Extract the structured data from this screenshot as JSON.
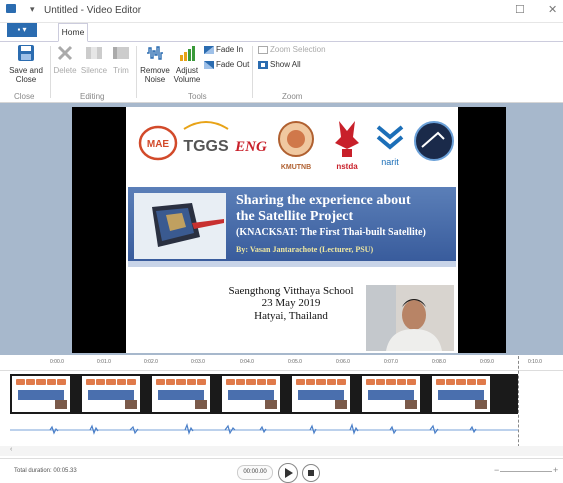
{
  "window": {
    "title": "Untitled - Video Editor",
    "restore_glyph": "☐",
    "close_glyph": "✕"
  },
  "tabs": {
    "file_label": "▪ ▾",
    "home_label": "Home"
  },
  "ribbon": {
    "close_group": {
      "save_close_label": "Save and Close",
      "group_label": "Close"
    },
    "editing_group": {
      "delete_label": "Delete",
      "silence_label": "Silence",
      "trim_label": "Trim",
      "group_label": "Editing"
    },
    "tools_group": {
      "remove_noise_label": "Remove Noise",
      "adjust_volume_label": "Adjust Volume",
      "fade_in_label": "Fade In",
      "fade_out_label": "Fade Out",
      "group_label": "Tools"
    },
    "zoom_group": {
      "zoom_selection_label": "Zoom Selection",
      "show_all_label": "Show All",
      "group_label": "Zoom"
    }
  },
  "slide": {
    "logos": [
      "MAE",
      "TGGS",
      "ENG",
      "KMUTNB",
      "nstda",
      "NARIT"
    ],
    "logo_texts": {
      "tggs": "TGGS",
      "eng": "ENG",
      "kmutnb": "KMUTNB",
      "nstda": "nstda",
      "narit": "narit",
      "mae": "MAE"
    },
    "title_line1": "Sharing the experience about",
    "title_line2": "the Satellite Project",
    "subtitle": "(KNACKSAT: The First Thai-built Satellite)",
    "byline": "By: Vasan Jantarachote (Lecturer, PSU)",
    "school": "Saengthong Vitthaya School",
    "date": "23 May 2019",
    "location": "Hatyai, Thailand"
  },
  "timeline": {
    "ticks": [
      "0:00.0",
      "0:01.0",
      "0:02.0",
      "0:03.0",
      "0:04.0",
      "0:05.0",
      "0:06.0",
      "0:07.0",
      "0:08.0",
      "0:09.0",
      "0:10.0"
    ]
  },
  "status": {
    "total_duration": "Total duration: 00:05.33",
    "current_time": "00:00.00"
  },
  "colors": {
    "accent": "#2b6cb0",
    "banner": "#4a6fae",
    "preview_bg": "#a7b8cc"
  }
}
